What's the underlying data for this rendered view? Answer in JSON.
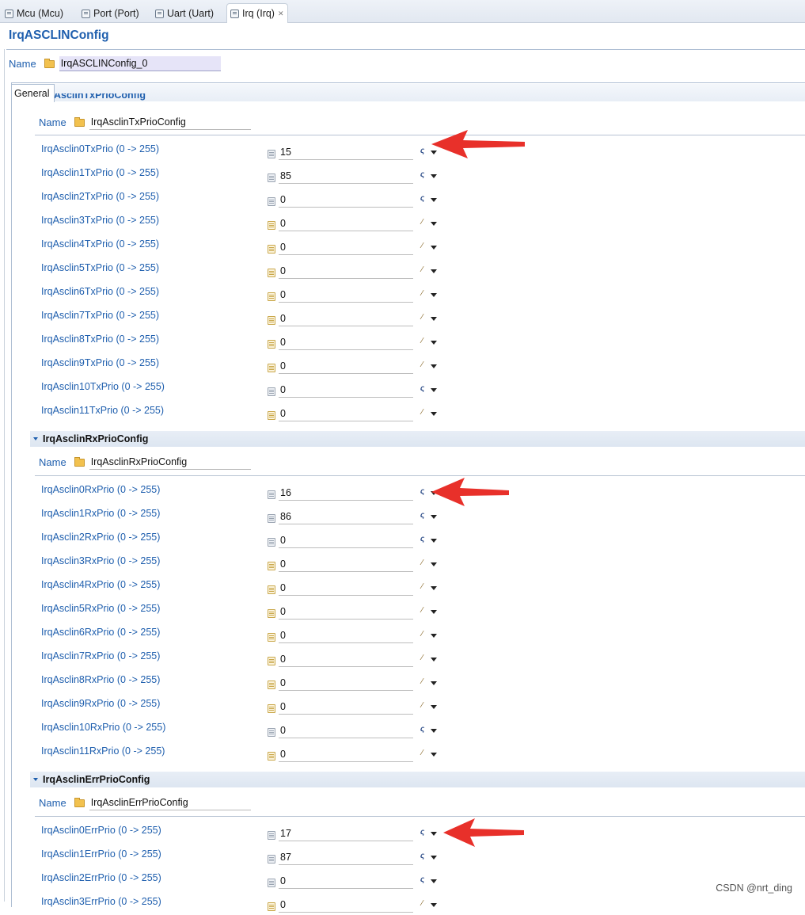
{
  "tabs": [
    {
      "label": "Mcu (Mcu)",
      "active": false
    },
    {
      "label": "Port (Port)",
      "active": false
    },
    {
      "label": "Uart (Uart)",
      "active": false
    },
    {
      "label": "Irq (Irq)",
      "active": true,
      "close": "✕"
    }
  ],
  "header": {
    "title": "IrqASCLINConfig",
    "name_label": "Name",
    "name_value": "IrqASCLINConfig_0"
  },
  "general_tab": {
    "label": "General"
  },
  "cutoff_container_title": "IrqAsclinTxPrioConfig",
  "sections": [
    {
      "title": "IrqAsclinTxPrioConfig",
      "header_visible": false,
      "name_label": "Name",
      "name_value": "IrqAsclinTxPrioConfig",
      "params": [
        {
          "label": "IrqAsclin0TxPrio (0 -> 255)",
          "value": "15",
          "mode": "calc",
          "doc": "plain"
        },
        {
          "label": "IrqAsclin1TxPrio (0 -> 255)",
          "value": "85",
          "mode": "calc",
          "doc": "plain"
        },
        {
          "label": "IrqAsclin2TxPrio (0 -> 255)",
          "value": "0",
          "mode": "calc",
          "doc": "plain"
        },
        {
          "label": "IrqAsclin3TxPrio (0 -> 255)",
          "value": "0",
          "mode": "pencil",
          "doc": "edit"
        },
        {
          "label": "IrqAsclin4TxPrio (0 -> 255)",
          "value": "0",
          "mode": "pencil",
          "doc": "edit"
        },
        {
          "label": "IrqAsclin5TxPrio (0 -> 255)",
          "value": "0",
          "mode": "pencil",
          "doc": "edit"
        },
        {
          "label": "IrqAsclin6TxPrio (0 -> 255)",
          "value": "0",
          "mode": "pencil",
          "doc": "edit"
        },
        {
          "label": "IrqAsclin7TxPrio (0 -> 255)",
          "value": "0",
          "mode": "pencil",
          "doc": "edit"
        },
        {
          "label": "IrqAsclin8TxPrio (0 -> 255)",
          "value": "0",
          "mode": "pencil",
          "doc": "edit"
        },
        {
          "label": "IrqAsclin9TxPrio (0 -> 255)",
          "value": "0",
          "mode": "pencil",
          "doc": "edit"
        },
        {
          "label": "IrqAsclin10TxPrio (0 -> 255)",
          "value": "0",
          "mode": "calc",
          "doc": "plain"
        },
        {
          "label": "IrqAsclin11TxPrio (0 -> 255)",
          "value": "0",
          "mode": "pencil",
          "doc": "edit"
        }
      ]
    },
    {
      "title": "IrqAsclinRxPrioConfig",
      "header_visible": true,
      "name_label": "Name",
      "name_value": "IrqAsclinRxPrioConfig",
      "params": [
        {
          "label": "IrqAsclin0RxPrio (0 -> 255)",
          "value": "16",
          "mode": "calc",
          "doc": "plain"
        },
        {
          "label": "IrqAsclin1RxPrio (0 -> 255)",
          "value": "86",
          "mode": "calc",
          "doc": "plain"
        },
        {
          "label": "IrqAsclin2RxPrio (0 -> 255)",
          "value": "0",
          "mode": "calc",
          "doc": "plain"
        },
        {
          "label": "IrqAsclin3RxPrio (0 -> 255)",
          "value": "0",
          "mode": "pencil",
          "doc": "edit"
        },
        {
          "label": "IrqAsclin4RxPrio (0 -> 255)",
          "value": "0",
          "mode": "pencil",
          "doc": "edit"
        },
        {
          "label": "IrqAsclin5RxPrio (0 -> 255)",
          "value": "0",
          "mode": "pencil",
          "doc": "edit"
        },
        {
          "label": "IrqAsclin6RxPrio (0 -> 255)",
          "value": "0",
          "mode": "pencil",
          "doc": "edit"
        },
        {
          "label": "IrqAsclin7RxPrio (0 -> 255)",
          "value": "0",
          "mode": "pencil",
          "doc": "edit"
        },
        {
          "label": "IrqAsclin8RxPrio (0 -> 255)",
          "value": "0",
          "mode": "pencil",
          "doc": "edit"
        },
        {
          "label": "IrqAsclin9RxPrio (0 -> 255)",
          "value": "0",
          "mode": "pencil",
          "doc": "edit"
        },
        {
          "label": "IrqAsclin10RxPrio (0 -> 255)",
          "value": "0",
          "mode": "calc",
          "doc": "plain"
        },
        {
          "label": "IrqAsclin11RxPrio (0 -> 255)",
          "value": "0",
          "mode": "pencil",
          "doc": "edit"
        }
      ]
    },
    {
      "title": "IrqAsclinErrPrioConfig",
      "header_visible": true,
      "name_label": "Name",
      "name_value": "IrqAsclinErrPrioConfig",
      "params": [
        {
          "label": "IrqAsclin0ErrPrio (0 -> 255)",
          "value": "17",
          "mode": "calc",
          "doc": "plain"
        },
        {
          "label": "IrqAsclin1ErrPrio (0 -> 255)",
          "value": "87",
          "mode": "calc",
          "doc": "plain"
        },
        {
          "label": "IrqAsclin2ErrPrio (0 -> 255)",
          "value": "0",
          "mode": "calc",
          "doc": "plain"
        },
        {
          "label": "IrqAsclin3ErrPrio (0 -> 255)",
          "value": "0",
          "mode": "pencil",
          "doc": "edit"
        }
      ]
    }
  ],
  "annotation_color": "#e8302a",
  "watermark": "CSDN @nrt_ding"
}
